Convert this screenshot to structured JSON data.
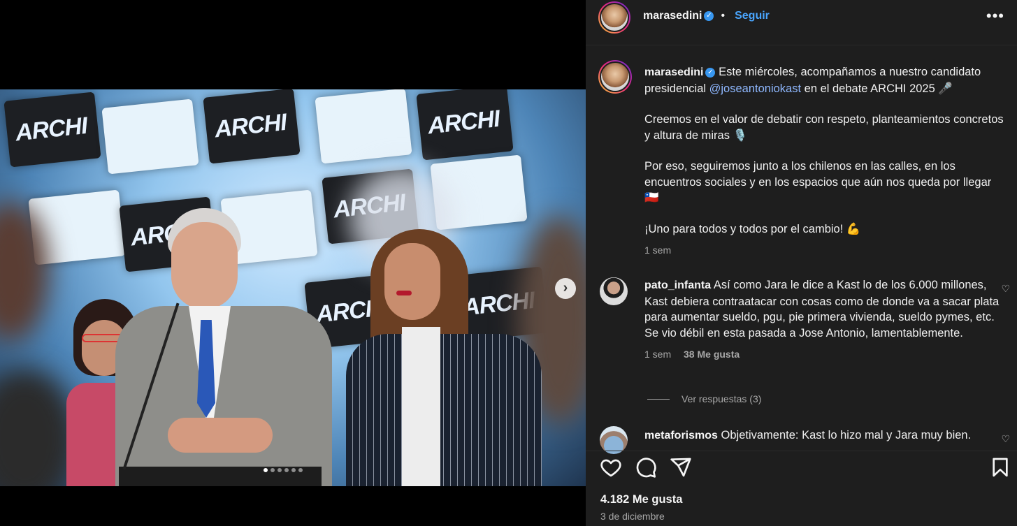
{
  "post": {
    "username": "marasedini",
    "follow_label": "Seguir",
    "bullet": "•",
    "more_label": "•••"
  },
  "caption": {
    "username": "marasedini",
    "line1": "Este miércoles, acompañamos a nuestro candidato presidencial ",
    "mention": "@joseantoniokast",
    "line1_end": " en el debate ARCHI 2025 🎤",
    "p2": "Creemos en el valor de debatir con respeto, planteamientos concretos y altura de miras 🎙️",
    "p3": "Por eso, seguiremos junto a los chilenos en las calles, en los encuentros sociales y en los espacios que aún nos queda por llegar 🇨🇱",
    "p4": "¡Uno para todos y todos por el cambio! 💪",
    "time": "1 sem"
  },
  "comments": [
    {
      "username": "pato_infanta",
      "text": "Así como Jara le dice a Kast lo de los 6.000 millones, Kast debiera contraatacar con cosas como de donde va a sacar plata para aumentar sueldo, pgu, pie primera vivienda, sueldo pymes, etc. Se vio débil en esta pasada a Jose Antonio, lamentablemente.",
      "time": "1 sem",
      "likes": "38 Me gusta",
      "replies": "Ver respuestas (3)"
    },
    {
      "username": "metaforismos",
      "text": "Objetivamente: Kast lo hizo mal y Jara muy bien."
    }
  ],
  "footer": {
    "likes": "4.182 Me gusta",
    "date": "3 de diciembre"
  },
  "media": {
    "logo_text": "ARCHI",
    "next_label": "›",
    "carousel_count": 6,
    "carousel_active": 1
  },
  "icons": {
    "like": "heart-icon",
    "comment": "comment-icon",
    "share": "share-icon",
    "save": "bookmark-icon"
  }
}
